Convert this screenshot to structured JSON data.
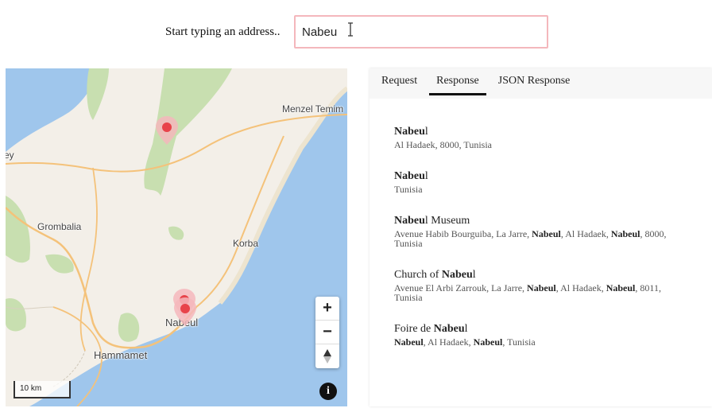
{
  "search": {
    "label": "Start typing an address..",
    "value": "Nabeu"
  },
  "map": {
    "labels": {
      "menzel": "Menzel Temim",
      "grombalia": "Grombalia",
      "korba": "Korba",
      "nabeul": "Nabeul",
      "hammamet": "Hammamet",
      "ey": "ey"
    },
    "zoom_in": "+",
    "zoom_out": "−",
    "compass": "▲",
    "scale": "10 km",
    "info": "i"
  },
  "tabs": [
    "Request",
    "Response",
    "JSON Response"
  ],
  "active_tab": "Response",
  "results": [
    {
      "title": [
        {
          "t": "Nabeu",
          "b": true
        },
        {
          "t": "l",
          "b": false
        }
      ],
      "sub": [
        {
          "t": "Al Hadaek, 8000, Tunisia",
          "b": false
        }
      ]
    },
    {
      "title": [
        {
          "t": "Nabeu",
          "b": true
        },
        {
          "t": "l",
          "b": false
        }
      ],
      "sub": [
        {
          "t": "Tunisia",
          "b": false
        }
      ]
    },
    {
      "title": [
        {
          "t": "Nabeu",
          "b": true
        },
        {
          "t": "l Museum",
          "b": false
        }
      ],
      "sub": [
        {
          "t": "Avenue Habib Bourguiba, La Jarre, ",
          "b": false
        },
        {
          "t": "Nabeul",
          "b": true
        },
        {
          "t": ", Al Hadaek, ",
          "b": false
        },
        {
          "t": "Nabeul",
          "b": true
        },
        {
          "t": ", 8000, Tunisia",
          "b": false
        }
      ]
    },
    {
      "title": [
        {
          "t": "Church of ",
          "b": false
        },
        {
          "t": "Nabeu",
          "b": true
        },
        {
          "t": "l",
          "b": false
        }
      ],
      "sub": [
        {
          "t": "Avenue El Arbi Zarrouk, La Jarre, ",
          "b": false
        },
        {
          "t": "Nabeul",
          "b": true
        },
        {
          "t": ", Al Hadaek, ",
          "b": false
        },
        {
          "t": "Nabeul",
          "b": true
        },
        {
          "t": ", 8011, Tunisia",
          "b": false
        }
      ]
    },
    {
      "title": [
        {
          "t": "Foire de ",
          "b": false
        },
        {
          "t": "Nabeu",
          "b": true
        },
        {
          "t": "l",
          "b": false
        }
      ],
      "sub": [
        {
          "t": "Nabeul",
          "b": true
        },
        {
          "t": ", Al Hadaek, ",
          "b": false
        },
        {
          "t": "Nabeul",
          "b": true
        },
        {
          "t": ", Tunisia",
          "b": false
        }
      ]
    }
  ],
  "colors": {
    "input_border": "#f4b7bc",
    "water": "#9fc6ec",
    "land": "#f3efe8",
    "park": "#c8dfb0",
    "road": "#f4c27a",
    "pin": "#e8434a"
  }
}
